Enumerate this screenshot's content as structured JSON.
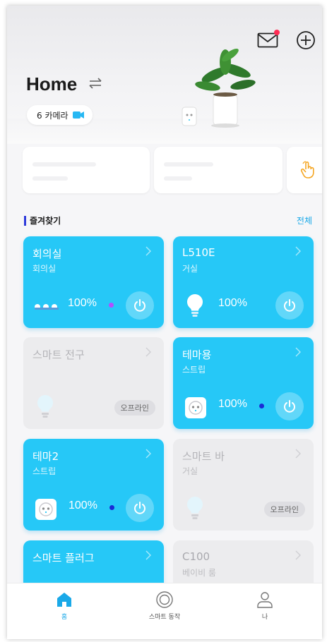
{
  "header": {
    "home_title": "Home",
    "camera_label": "6 카메라",
    "has_unread_mail": true
  },
  "favorites": {
    "title": "즐겨찾기",
    "all_label": "전체"
  },
  "devices": [
    {
      "name": "회의실",
      "room": "회의실",
      "status": "on",
      "brightness": "100%",
      "icon": "light-strip-icon",
      "dot_color": "#b44dff"
    },
    {
      "name": "L510E",
      "room": "거실",
      "status": "on",
      "brightness": "100%",
      "icon": "bulb-icon"
    },
    {
      "name": "스마트 전구",
      "room": "",
      "status": "offline",
      "offline_label": "오프라인",
      "icon": "bulb-icon"
    },
    {
      "name": "테마용",
      "room": "스트립",
      "status": "on",
      "brightness": "100%",
      "icon": "outlet-icon",
      "dot_color": "#1a2bd6"
    },
    {
      "name": "테마2",
      "room": "스트립",
      "status": "on",
      "brightness": "100%",
      "icon": "outlet-icon",
      "dot_color": "#1a2bd6"
    },
    {
      "name": "스마트 바",
      "room": "거실",
      "status": "offline",
      "offline_label": "오프라인",
      "icon": "bulb-icon"
    },
    {
      "name": "스마트 플러그",
      "room": "",
      "status": "on",
      "icon": "plug-icon"
    },
    {
      "name": "C100",
      "room": "베이비 룸",
      "status": "off",
      "icon": "camera-icon"
    }
  ],
  "nav": {
    "items": [
      {
        "label": "홈",
        "icon": "home-icon",
        "active": true
      },
      {
        "label": "스마트 동작",
        "icon": "smart-action-icon",
        "active": false
      },
      {
        "label": "나",
        "icon": "profile-icon",
        "active": false
      }
    ]
  },
  "colors": {
    "accent": "#26c8f7",
    "link": "#1aa9e8",
    "offline_card": "#ececee",
    "notification_dot": "#ff2d55"
  }
}
